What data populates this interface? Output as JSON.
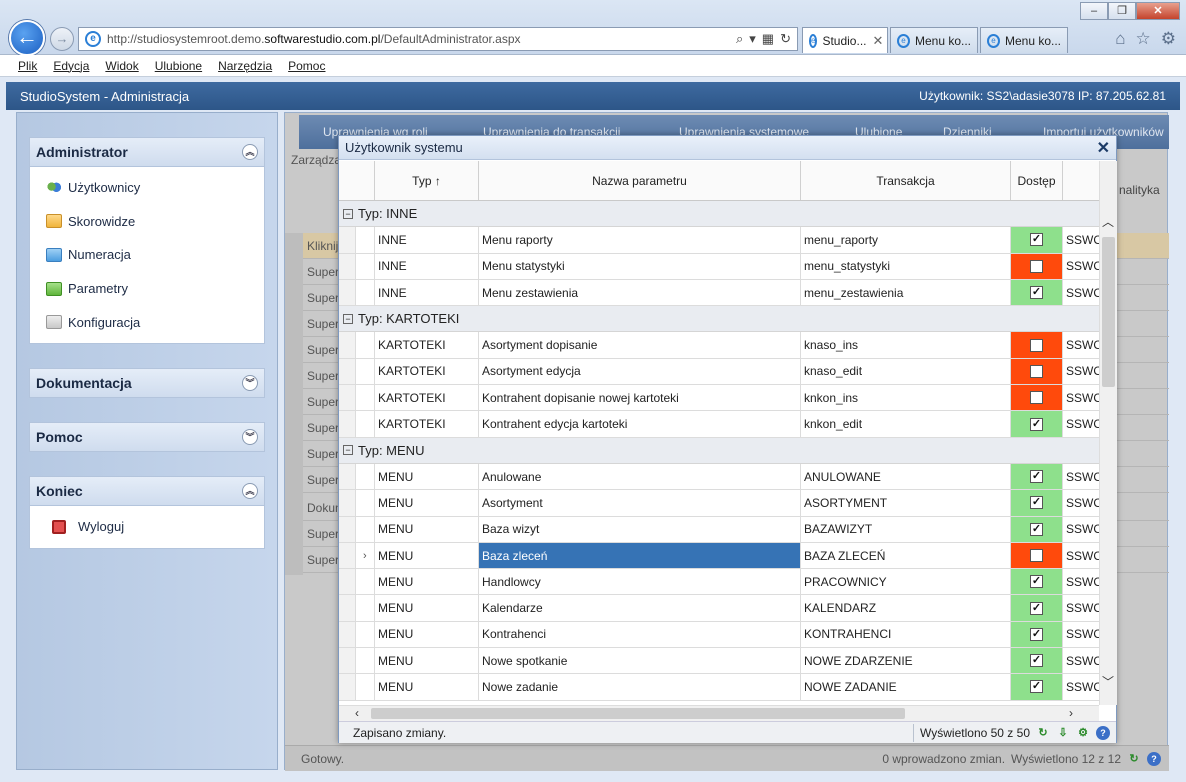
{
  "browser": {
    "url_prefix": "http://studiosystemroot.demo.",
    "url_host": "softwarestudio.com.pl",
    "url_path": "/DefaultAdministrator.aspx",
    "tabs": [
      "Studio...",
      "Menu ko...",
      "Menu ko..."
    ],
    "menu": [
      "Plik",
      "Edycja",
      "Widok",
      "Ulubione",
      "Narzędzia",
      "Pomoc"
    ]
  },
  "app": {
    "title": "StudioSystem - Administracja",
    "user": "Użytkownik: SS2\\adasie3078 IP: 87.205.62.81"
  },
  "sidebar": {
    "panels": [
      {
        "title": "Administrator",
        "items": [
          "Użytkownicy",
          "Skorowidze",
          "Numeracja",
          "Parametry",
          "Konfiguracja"
        ]
      },
      {
        "title": "Dokumentacja"
      },
      {
        "title": "Pomoc"
      },
      {
        "title": "Koniec",
        "items": [
          "Wyloguj"
        ]
      }
    ]
  },
  "background": {
    "toolbar": [
      "Uprawnienia wg roli",
      "Uprawnienia do transakcji",
      "Uprawnienia systemowe",
      "Ulubione",
      "Dzienniki",
      "Importuj użytkowników"
    ],
    "breadcrumb": "Zarządza",
    "analityka": "nalityka",
    "rows": [
      "Kliknij",
      "Super",
      "Super",
      "Super",
      "Super",
      "Super",
      "Super",
      "Super",
      "Super",
      "Super",
      "Dokum",
      "Super",
      "Super"
    ],
    "status_left": "Gotowy.",
    "status_mid": "0 wprowadzono zmian.",
    "status_right": "Wyświetlono 12 z 12"
  },
  "modal": {
    "title": "Użytkownik systemu",
    "columns": [
      "Typ",
      "Nazwa parametru",
      "Transakcja",
      "Dostęp",
      "N"
    ],
    "sort_indicator": "↑",
    "groups": [
      {
        "label": "Typ: INNE",
        "rows": [
          {
            "typ": "INNE",
            "nazwa": "Menu raporty",
            "transakcja": "menu_raporty",
            "dostep": true,
            "n": "SSWO"
          },
          {
            "typ": "INNE",
            "nazwa": "Menu statystyki",
            "transakcja": "menu_statystyki",
            "dostep": false,
            "n": "SSWO"
          },
          {
            "typ": "INNE",
            "nazwa": "Menu zestawienia",
            "transakcja": "menu_zestawienia",
            "dostep": true,
            "n": "SSWO"
          }
        ]
      },
      {
        "label": "Typ: KARTOTEKI",
        "rows": [
          {
            "typ": "KARTOTEKI",
            "nazwa": "Asortyment dopisanie",
            "transakcja": "knaso_ins",
            "dostep": false,
            "n": "SSWO"
          },
          {
            "typ": "KARTOTEKI",
            "nazwa": "Asortyment edycja",
            "transakcja": "knaso_edit",
            "dostep": false,
            "n": "SSWO"
          },
          {
            "typ": "KARTOTEKI",
            "nazwa": "Kontrahent dopisanie nowej kartoteki",
            "transakcja": "knkon_ins",
            "dostep": false,
            "n": "SSWO"
          },
          {
            "typ": "KARTOTEKI",
            "nazwa": "Kontrahent edycja kartoteki",
            "transakcja": "knkon_edit",
            "dostep": true,
            "n": "SSWO"
          }
        ]
      },
      {
        "label": "Typ: MENU",
        "rows": [
          {
            "typ": "MENU",
            "nazwa": "Anulowane",
            "transakcja": "ANULOWANE",
            "dostep": true,
            "n": "SSWO"
          },
          {
            "typ": "MENU",
            "nazwa": "Asortyment",
            "transakcja": "ASORTYMENT",
            "dostep": true,
            "n": "SSWO"
          },
          {
            "typ": "MENU",
            "nazwa": "Baza wizyt",
            "transakcja": "BAZAWIZYT",
            "dostep": true,
            "n": "SSWO"
          },
          {
            "typ": "MENU",
            "nazwa": "Baza zleceń",
            "transakcja": "BAZA ZLECEŃ",
            "dostep": false,
            "n": "SSWO",
            "selected": true
          },
          {
            "typ": "MENU",
            "nazwa": "Handlowcy",
            "transakcja": "PRACOWNICY",
            "dostep": true,
            "n": "SSWO"
          },
          {
            "typ": "MENU",
            "nazwa": "Kalendarze",
            "transakcja": "KALENDARZ",
            "dostep": true,
            "n": "SSWO"
          },
          {
            "typ": "MENU",
            "nazwa": "Kontrahenci",
            "transakcja": "KONTRAHENCI",
            "dostep": true,
            "n": "SSWO"
          },
          {
            "typ": "MENU",
            "nazwa": "Nowe spotkanie",
            "transakcja": "NOWE ZDARZENIE",
            "dostep": true,
            "n": "SSWO"
          },
          {
            "typ": "MENU",
            "nazwa": "Nowe zadanie",
            "transakcja": "NOWE ZADANIE",
            "dostep": true,
            "n": "SSWO"
          }
        ]
      }
    ],
    "status_left": "Zapisano zmiany.",
    "status_right": "Wyświetlono 50 z 50"
  },
  "colors": {
    "access_on": "#8ee08c",
    "access_off": "#ff4a0c",
    "selected": "#3673b5",
    "header": "#2d5688"
  }
}
